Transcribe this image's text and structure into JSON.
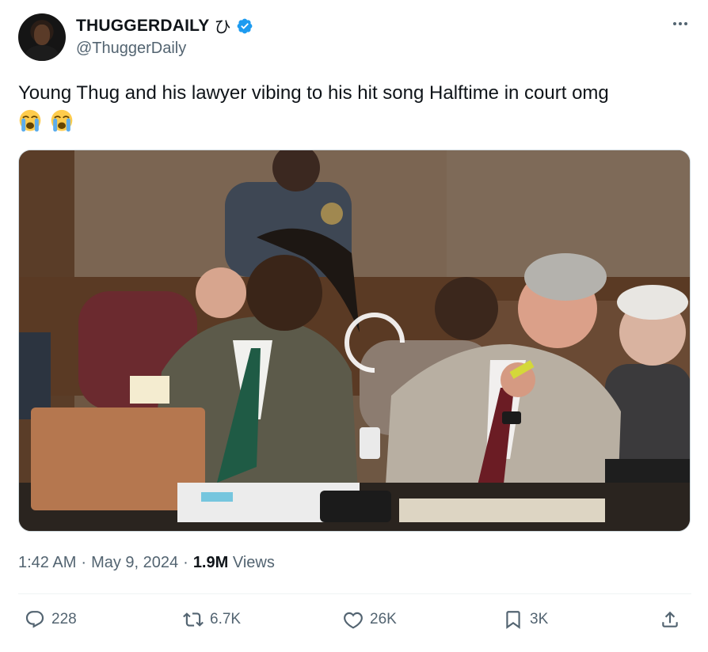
{
  "author": {
    "display_name": "THUGGERDAILY",
    "name_glyph": "ひ",
    "handle": "@ThuggerDaily",
    "verified": true
  },
  "tweet": {
    "text": "Young Thug and his lawyer vibing to his hit song Halftime in court omg",
    "emojis": [
      "loudly-crying-face",
      "loudly-crying-face"
    ]
  },
  "meta": {
    "time": "1:42 AM",
    "separator": "·",
    "date": "May 9, 2024",
    "views_count": "1.9M",
    "views_label": "Views"
  },
  "actions": {
    "replies": "228",
    "reposts": "6.7K",
    "likes": "26K",
    "bookmarks": "3K"
  },
  "colors": {
    "text": "#0f1419",
    "secondary": "#536471",
    "verified": "#1d9bf0",
    "divider": "#eff3f4"
  }
}
